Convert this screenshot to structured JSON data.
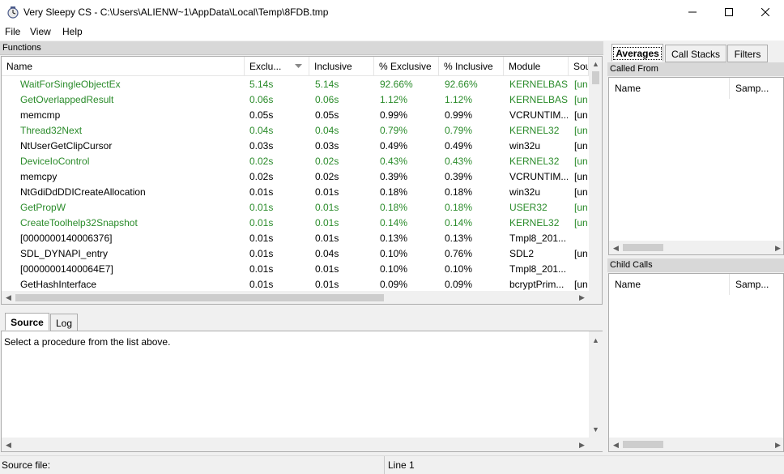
{
  "window": {
    "title": "Very Sleepy CS - C:\\Users\\ALIENW~1\\AppData\\Local\\Temp\\8FDB.tmp"
  },
  "menu": [
    "File",
    "View",
    "Help"
  ],
  "functions": {
    "header": "Functions",
    "columns": [
      "Name",
      "Exclu...",
      "Inclusive",
      "% Exclusive",
      "% Inclusive",
      "Module",
      "Sou"
    ],
    "sort_column": "Exclu...",
    "rows": [
      {
        "name": "WaitForSingleObjectEx",
        "exclusive": "5.14s",
        "inclusive": "5.14s",
        "pct_exclusive": "92.66%",
        "pct_inclusive": "92.66%",
        "module": "KERNELBASE",
        "source": "[un",
        "green": true
      },
      {
        "name": "GetOverlappedResult",
        "exclusive": "0.06s",
        "inclusive": "0.06s",
        "pct_exclusive": "1.12%",
        "pct_inclusive": "1.12%",
        "module": "KERNELBASE",
        "source": "[un",
        "green": true
      },
      {
        "name": "memcmp",
        "exclusive": "0.05s",
        "inclusive": "0.05s",
        "pct_exclusive": "0.99%",
        "pct_inclusive": "0.99%",
        "module": "VCRUNTIM...",
        "source": "[un",
        "green": false
      },
      {
        "name": "Thread32Next",
        "exclusive": "0.04s",
        "inclusive": "0.04s",
        "pct_exclusive": "0.79%",
        "pct_inclusive": "0.79%",
        "module": "KERNEL32",
        "source": "[un",
        "green": true
      },
      {
        "name": "NtUserGetClipCursor",
        "exclusive": "0.03s",
        "inclusive": "0.03s",
        "pct_exclusive": "0.49%",
        "pct_inclusive": "0.49%",
        "module": "win32u",
        "source": "[un",
        "green": false
      },
      {
        "name": "DeviceIoControl",
        "exclusive": "0.02s",
        "inclusive": "0.02s",
        "pct_exclusive": "0.43%",
        "pct_inclusive": "0.43%",
        "module": "KERNEL32",
        "source": "[un",
        "green": true
      },
      {
        "name": "memcpy",
        "exclusive": "0.02s",
        "inclusive": "0.02s",
        "pct_exclusive": "0.39%",
        "pct_inclusive": "0.39%",
        "module": "VCRUNTIM...",
        "source": "[un",
        "green": false
      },
      {
        "name": "NtGdiDdDDICreateAllocation",
        "exclusive": "0.01s",
        "inclusive": "0.01s",
        "pct_exclusive": "0.18%",
        "pct_inclusive": "0.18%",
        "module": "win32u",
        "source": "[un",
        "green": false
      },
      {
        "name": "GetPropW",
        "exclusive": "0.01s",
        "inclusive": "0.01s",
        "pct_exclusive": "0.18%",
        "pct_inclusive": "0.18%",
        "module": "USER32",
        "source": "[un",
        "green": true
      },
      {
        "name": "CreateToolhelp32Snapshot",
        "exclusive": "0.01s",
        "inclusive": "0.01s",
        "pct_exclusive": "0.14%",
        "pct_inclusive": "0.14%",
        "module": "KERNEL32",
        "source": "[un",
        "green": true
      },
      {
        "name": "[0000000140006376]",
        "exclusive": "0.01s",
        "inclusive": "0.01s",
        "pct_exclusive": "0.13%",
        "pct_inclusive": "0.13%",
        "module": "Tmpl8_201...",
        "source": "",
        "green": false
      },
      {
        "name": "SDL_DYNAPI_entry",
        "exclusive": "0.01s",
        "inclusive": "0.04s",
        "pct_exclusive": "0.10%",
        "pct_inclusive": "0.76%",
        "module": "SDL2",
        "source": "[un",
        "green": false
      },
      {
        "name": "[00000001400064E7]",
        "exclusive": "0.01s",
        "inclusive": "0.01s",
        "pct_exclusive": "0.10%",
        "pct_inclusive": "0.10%",
        "module": "Tmpl8_201...",
        "source": "",
        "green": false
      },
      {
        "name": "GetHashInterface",
        "exclusive": "0.01s",
        "inclusive": "0.01s",
        "pct_exclusive": "0.09%",
        "pct_inclusive": "0.09%",
        "module": "bcryptPrim...",
        "source": "[un",
        "green": false
      }
    ]
  },
  "bottom_tabs": [
    "Source",
    "Log"
  ],
  "active_bottom_tab": "Source",
  "source_text": "Select a procedure from the list above.",
  "right_tabs": [
    "Averages",
    "Call Stacks",
    "Filters"
  ],
  "active_right_tab": "Averages",
  "called_from": {
    "header": "Called From",
    "columns": [
      "Name",
      "Samp..."
    ]
  },
  "child_calls": {
    "header": "Child Calls",
    "columns": [
      "Name",
      "Samp..."
    ]
  },
  "status": {
    "left": "Source file:",
    "right": "Line 1"
  },
  "colors": {
    "green_text": "#2a8b2a"
  }
}
